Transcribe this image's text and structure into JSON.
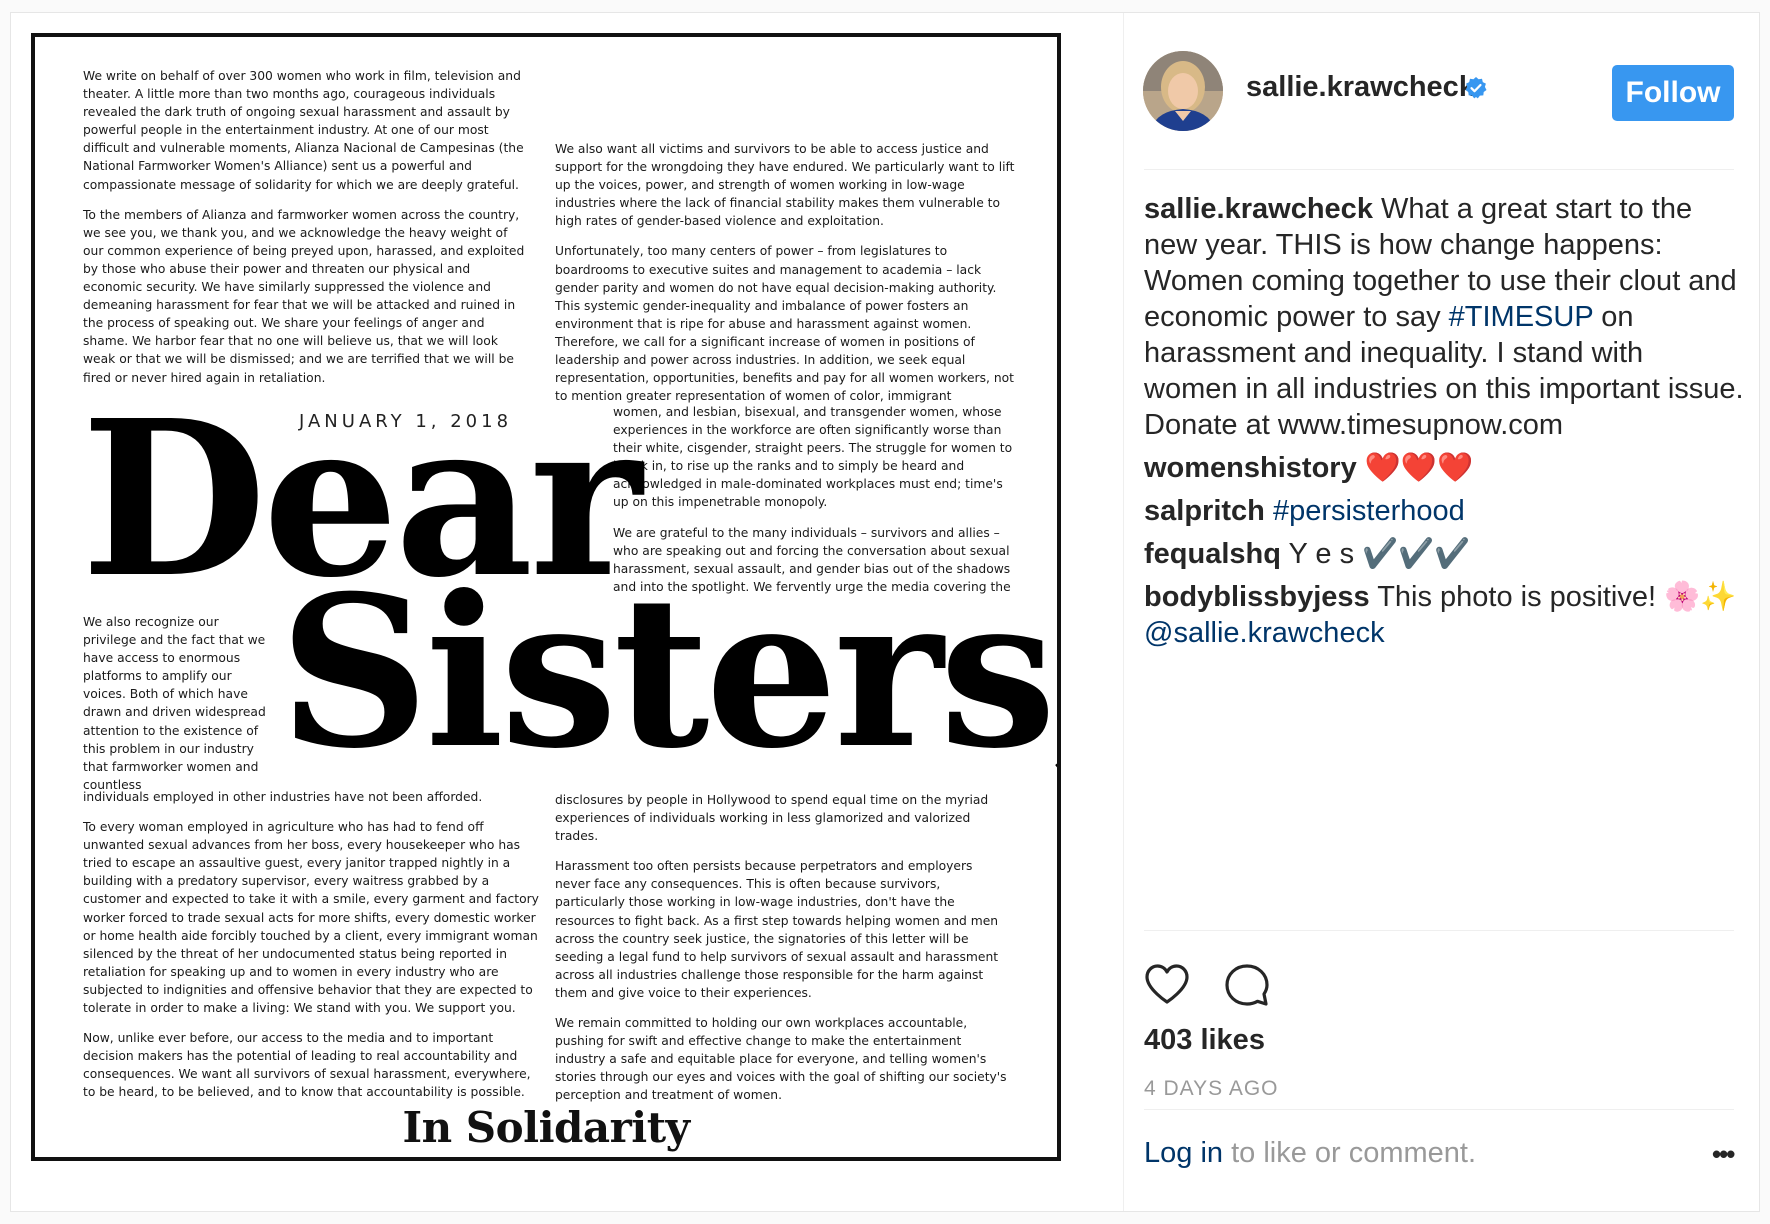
{
  "letter": {
    "col_left_1": [
      "We write on behalf of over 300 women who work in film, television and theater. A little more than two months ago, courageous individuals revealed the dark truth of ongoing sexual harassment and assault by powerful people in the entertainment industry. At one of our most difficult and vulnerable moments, Alianza Nacional de Campesinas (the National Farmworker Women's Alliance) sent us a powerful and compassionate message of solidarity for which we are deeply grateful.",
      "To the members of Alianza and farmworker women across the country, we see you, we thank you, and we acknowledge the heavy weight of our common experience of being preyed upon, harassed, and exploited by those who abuse their power and threaten our physical and economic security. We have similarly suppressed the violence and demeaning harassment for fear that we will be attacked and ruined in the process of speaking out. We share your feelings of anger and shame. We harbor fear that no one will believe us, that we will look weak or that we will be dismissed; and we are terrified that we will be fired or never hired again in retaliation."
    ],
    "col_right_1": [
      "We also want all victims and survivors to be able to access justice and support for the wrongdoing they have endured. We particularly want to lift up the voices, power, and strength of women working in low-wage industries where the lack of financial stability makes them vulnerable to high rates of gender-based violence and exploitation.",
      "Unfortunately, too many centers of power – from legislatures to boardrooms to executive suites and management to academia – lack gender parity and women do not have equal decision-making authority. This systemic gender-inequality and imbalance of power fosters an environment that is ripe for abuse and harassment against women. Therefore, we call for a significant increase of women in positions of leadership and power across industries. In addition, we seek equal representation, opportunities, benefits and pay for all women workers, not to mention greater representation of women of color, immigrant"
    ],
    "col_right_2": [
      "women, and lesbian, bisexual, and transgender women, whose experiences in the workforce are often significantly worse than their white, cisgender, straight peers. The struggle for women to break in, to rise up the ranks and to simply be heard and acknowledged in male-dominated workplaces must end; time's up on this impenetrable monopoly.",
      "We are grateful to the many individuals – survivors and allies – who are speaking out and forcing the conversation about sexual harassment, sexual assault, and gender bias out of the shadows and into the spotlight. We fervently urge the media covering the"
    ],
    "col_left_2": "We also recognize our privilege and the fact that we have access to enormous platforms to amplify our voices. Both of which have drawn and driven widespread attention to the existence of this problem in our industry that farmworker women and countless",
    "col_left_3": [
      "individuals employed in other industries have not been afforded.",
      "To every woman employed in agriculture who has had to fend off unwanted sexual advances from her boss, every housekeeper who has tried to escape an assaultive guest, every janitor trapped nightly in a building with a predatory supervisor, every waitress grabbed by a customer and expected to take it with a smile, every garment and factory worker forced to trade sexual acts for more shifts, every domestic worker or home health aide forcibly touched by a client, every immigrant woman silenced by the threat of her undocumented status being reported in retaliation for speaking up and to women in every industry who are subjected to indignities and offensive behavior that they are expected to tolerate in order to make a living: We stand with you. We support you.",
      "Now, unlike ever before, our access to the media and to important decision makers has the potential of leading to real accountability and consequences. We want all survivors of sexual harassment, everywhere, to be heard, to be believed, and to know that accountability is possible."
    ],
    "col_right_3": [
      "disclosures by people in Hollywood to spend equal time on the myriad experiences of individuals working in less glamorized and valorized trades.",
      "Harassment too often persists because perpetrators and employers never face any consequences. This is often because survivors, particularly those working in low-wage industries, don't have the resources to fight back. As a first step towards helping women and men across the country seek justice, the signatories of this letter will be seeding a legal fund to help survivors of sexual assault and harassment across all industries challenge those responsible for the harm against them and give voice to their experiences.",
      "We remain committed to holding our own workplaces accountable, pushing for swift and effective change to make the entertainment industry a safe and equitable place for everyone, and telling women's stories through our eyes and voices with the goal of shifting our society's perception and treatment of women."
    ],
    "date": "JANUARY 1, 2018",
    "headline_1": "Dear",
    "headline_2": "Sisters,",
    "signoff": "In Solidarity"
  },
  "header": {
    "username": "sallie.krawcheck",
    "follow_label": "Follow",
    "avatar_icon": "avatar-photo",
    "verified_icon": "verified-badge-icon",
    "follow_color": "#3897f0"
  },
  "comments": [
    {
      "user": "sallie.krawcheck",
      "pre": " What a great start to the new year. THIS is how change happens: Women coming together to use their clout and economic power to say ",
      "link": "#TIMESUP",
      "post": " on harassment and inequality. I stand with women in all industries on this important issue. Donate at www.timesupnow.com"
    },
    {
      "user": "womenshistory",
      "pre": " ❤️❤️❤️",
      "link": "",
      "post": ""
    },
    {
      "user": "salpritch",
      "pre": " ",
      "link": "#persisterhood",
      "post": ""
    },
    {
      "user": "fequalshq",
      "pre": " Y e s ✔️✔️✔️",
      "link": "",
      "post": ""
    },
    {
      "user": "bodyblissbyjess",
      "pre": " This photo is positive! 🌸✨ ",
      "link": "@sallie.krawcheck",
      "post": ""
    }
  ],
  "actions": {
    "like_icon": "heart-icon",
    "comment_icon": "comment-bubble-icon",
    "more_icon": "more-options-icon"
  },
  "likes": "403 likes",
  "time_ago": "4 DAYS AGO",
  "login": {
    "link": "Log in",
    "rest": " to like or comment.",
    "more": "•••"
  }
}
